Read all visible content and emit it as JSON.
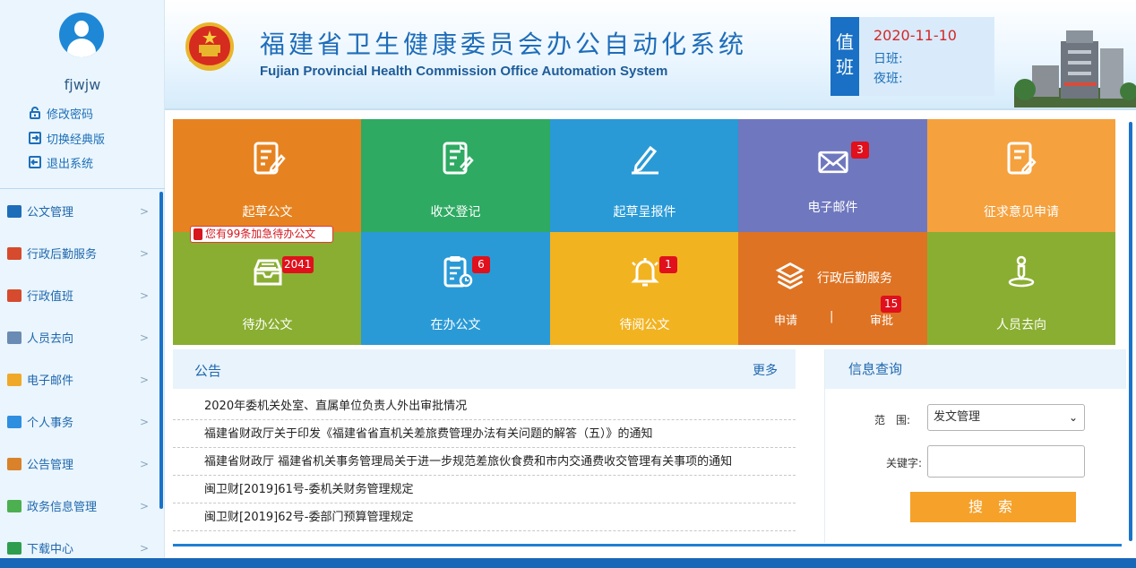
{
  "user": {
    "name": "fjwjw",
    "links": [
      "修改密码",
      "切换经典版",
      "退出系统"
    ]
  },
  "sidebar": {
    "items": [
      {
        "label": "公文管理",
        "icon": "megaphone-icon",
        "color": "#1e6db9"
      },
      {
        "label": "行政后勤服务",
        "icon": "truck-icon",
        "color": "#d64a2e"
      },
      {
        "label": "行政值班",
        "icon": "truck-icon",
        "color": "#d64a2e"
      },
      {
        "label": "人员去向",
        "icon": "building-icon",
        "color": "#6a8bb3"
      },
      {
        "label": "电子邮件",
        "icon": "mail-icon",
        "color": "#f0a829"
      },
      {
        "label": "个人事务",
        "icon": "pencil-icon",
        "color": "#2e8ee0"
      },
      {
        "label": "公告管理",
        "icon": "person-icon",
        "color": "#d9822b"
      },
      {
        "label": "政务信息管理",
        "icon": "person-icon",
        "color": "#4caf50"
      },
      {
        "label": "下载中心",
        "icon": "download-icon",
        "color": "#2e9e4e"
      }
    ]
  },
  "header": {
    "title": "福建省卫生健康委员会办公自动化系统",
    "subtitle": "Fujian Provincial Health Commission Office Automation System"
  },
  "duty": {
    "tag": "值班",
    "date": "2020-11-10",
    "day": "日班:",
    "night": "夜班:"
  },
  "tiles": [
    {
      "label": "起草公文",
      "color": "#e68320",
      "icon": "draft-icon"
    },
    {
      "label": "收文登记",
      "color": "#2eaa62",
      "icon": "receive-icon"
    },
    {
      "label": "起草呈报件",
      "color": "#2a9ad6",
      "icon": "write-icon"
    },
    {
      "label": "电子邮件",
      "color": "#6f78bf",
      "icon": "envelope-icon",
      "badge": "3"
    },
    {
      "label": "征求意见申请",
      "color": "#f5a13d",
      "icon": "opinion-icon"
    },
    {
      "label": "待办公文",
      "color": "#8aae31",
      "icon": "inbox-icon",
      "badge": "2041"
    },
    {
      "label": "在办公文",
      "color": "#2a9ad6",
      "icon": "clipboard-icon",
      "badge": "6"
    },
    {
      "label": "待阅公文",
      "color": "#f2b321",
      "icon": "bell-icon",
      "badge": "1"
    },
    {
      "label": "行政后勤服务",
      "color": "#de7323",
      "icon": "layers-icon",
      "sub_apply": "申请",
      "sub_sep": "|",
      "sub_approve": "审批",
      "badge": "15"
    },
    {
      "label": "人员去向",
      "color": "#8aae31",
      "icon": "person-location-icon"
    }
  ],
  "alert": "您有99条加急待办公文",
  "notice": {
    "title": "公告",
    "more": "更多",
    "items": [
      "2020年委机关处室、直属单位负责人外出审批情况",
      "福建省财政厅关于印发《福建省省直机关差旅费管理办法有关问题的解答（五）》的通知",
      "福建省财政厅 福建省机关事务管理局关于进一步规范差旅伙食费和市内交通费收交管理有关事项的通知",
      "闽卫财[2019]61号-委机关财务管理规定",
      "闽卫财[2019]62号-委部门预算管理规定"
    ]
  },
  "query": {
    "title": "信息查询",
    "scope_label": "范　围:",
    "scope_value": "发文管理",
    "keyword_label": "关键字:",
    "keyword_value": "",
    "search_label": "搜 索"
  }
}
